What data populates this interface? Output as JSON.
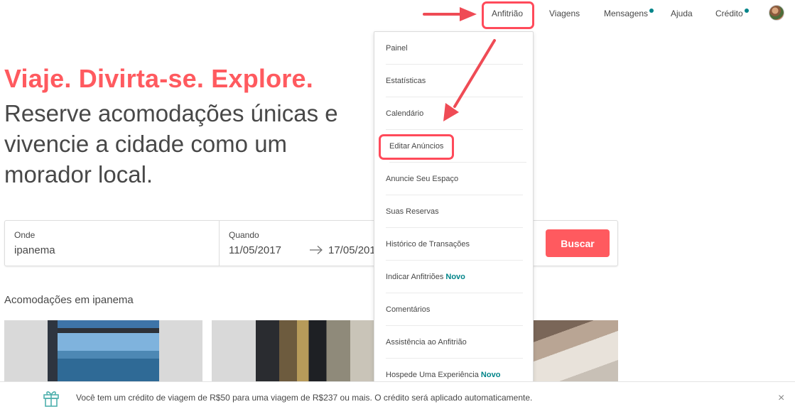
{
  "nav": {
    "host": "Anfitrião",
    "trips": "Viagens",
    "messages": "Mensagens",
    "help": "Ajuda",
    "credit": "Crédito"
  },
  "hero": {
    "title": "Viaje. Divirta-se. Explore.",
    "subtitle": "Reserve acomodações únicas e vivencie a cidade como um morador local."
  },
  "search": {
    "where_label": "Onde",
    "where_value": "ipanema",
    "when_label": "Quando",
    "checkin": "11/05/2017",
    "checkout": "17/05/2017",
    "button": "Buscar"
  },
  "listings": {
    "title": "Acomodações em ipanema"
  },
  "host_menu": {
    "items": [
      {
        "label": "Painel"
      },
      {
        "label": "Estatísticas"
      },
      {
        "label": "Calendário"
      },
      {
        "label": "Editar Anúncios"
      },
      {
        "label": "Anuncie Seu Espaço"
      },
      {
        "label": "Suas Reservas"
      },
      {
        "label": "Histórico de Transações"
      },
      {
        "label": "Indicar Anfitriões",
        "badge": "Novo"
      },
      {
        "label": "Comentários"
      },
      {
        "label": "Assistência ao Anfitrião"
      },
      {
        "label": "Hospede Uma Experiência",
        "badge": "Novo"
      }
    ]
  },
  "banner": {
    "text": "Você tem um crédito de viagem de R$50 para uma viagem de R$237 ou mais. O crédito será aplicado automaticamente.",
    "close": "×"
  },
  "colors": {
    "brand": "#ff5a5f",
    "teal": "#008489",
    "annotation": "#ff4a5a"
  },
  "icons": [
    "gift-icon",
    "arrow-right-icon",
    "close-icon",
    "avatar"
  ]
}
